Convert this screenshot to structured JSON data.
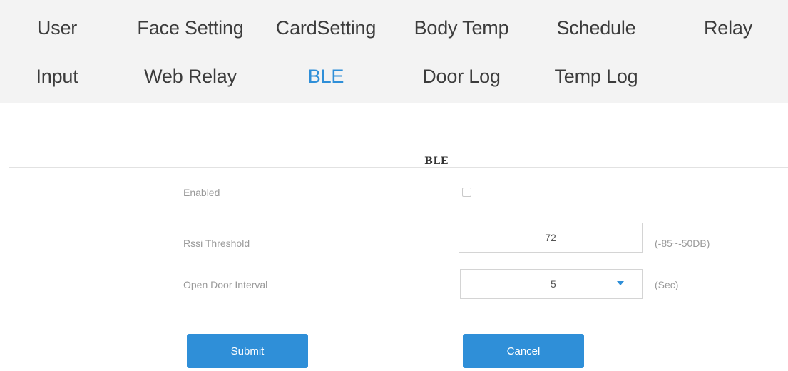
{
  "tabs": {
    "row1": [
      "User",
      "Face Setting",
      "CardSetting",
      "Body Temp",
      "Schedule",
      "Relay"
    ],
    "row2": [
      "Input",
      "Web Relay",
      "BLE",
      "Door Log",
      "Temp Log"
    ],
    "active": "BLE"
  },
  "section": {
    "title": "BLE"
  },
  "form": {
    "enabled": {
      "label": "Enabled",
      "checked": false
    },
    "rssi": {
      "label": "Rssi Threshold",
      "value": "72",
      "range": "(-85~-50DB)"
    },
    "interval": {
      "label": "Open Door Interval",
      "value": "5",
      "unit": "(Sec)"
    }
  },
  "buttons": {
    "submit": "Submit",
    "cancel": "Cancel"
  },
  "colors": {
    "accent": "#2f8fd8",
    "tab_bg": "#f3f3f3",
    "muted_text": "#9a9a9a"
  }
}
